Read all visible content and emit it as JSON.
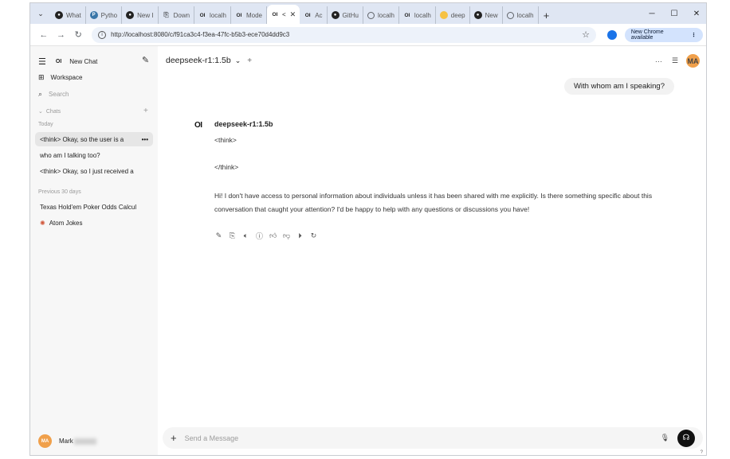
{
  "browser": {
    "tabs": [
      {
        "icon": "github-icon",
        "label": "What"
      },
      {
        "icon": "python-icon",
        "label": "Pytho"
      },
      {
        "icon": "github-icon",
        "label": "New I"
      },
      {
        "icon": "document-icon",
        "label": "Down"
      },
      {
        "icon": "openwebui-icon",
        "label": "localh"
      },
      {
        "icon": "openwebui-icon",
        "label": "Mode"
      },
      {
        "icon": "openwebui-icon",
        "label": "<",
        "active": true
      },
      {
        "icon": "openwebui-icon",
        "label": "Ac"
      },
      {
        "icon": "github-icon",
        "label": "GitHu"
      },
      {
        "icon": "globe-icon",
        "label": "localh"
      },
      {
        "icon": "openwebui-icon",
        "label": "localh"
      },
      {
        "icon": "huggingface-icon",
        "label": "deep"
      },
      {
        "icon": "github-icon",
        "label": "New"
      },
      {
        "icon": "globe-icon",
        "label": "localh"
      }
    ],
    "url": "http://localhost:8080/c/f91ca3c4-f3ea-47fc-b5b3-ece70d4dd9c3",
    "new_chrome_label": "New Chrome available"
  },
  "sidebar": {
    "logo": "OI",
    "new_chat": "New Chat",
    "workspace": "Workspace",
    "search_placeholder": "Search",
    "chats_header": "Chats",
    "today_label": "Today",
    "today_items": [
      "<think> Okay, so the user is a",
      "who am I talking too?",
      "<think> Okay, so I just received a"
    ],
    "previous_label": "Previous 30 days",
    "previous_items": [
      "Texas Hold'em Poker Odds Calcul",
      "Atom Jokes"
    ],
    "user_initials": "MA",
    "user_name": "Mark"
  },
  "main": {
    "model_name": "deepseek-r1:1.5b",
    "user_initials": "MA",
    "user_message": "With whom am I speaking?",
    "bot_logo": "OI",
    "bot_name": "deepseek-r1:1.5b",
    "think_open": "<think>",
    "think_close": "</think>",
    "bot_response": "Hi! I don't have access to personal information about individuals unless it has been shared with me explicitly. Is there something specific about this conversation that caught your attention? I'd be happy to help with any questions or discussions you have!",
    "composer_placeholder": "Send a Message",
    "help_label": "?"
  }
}
